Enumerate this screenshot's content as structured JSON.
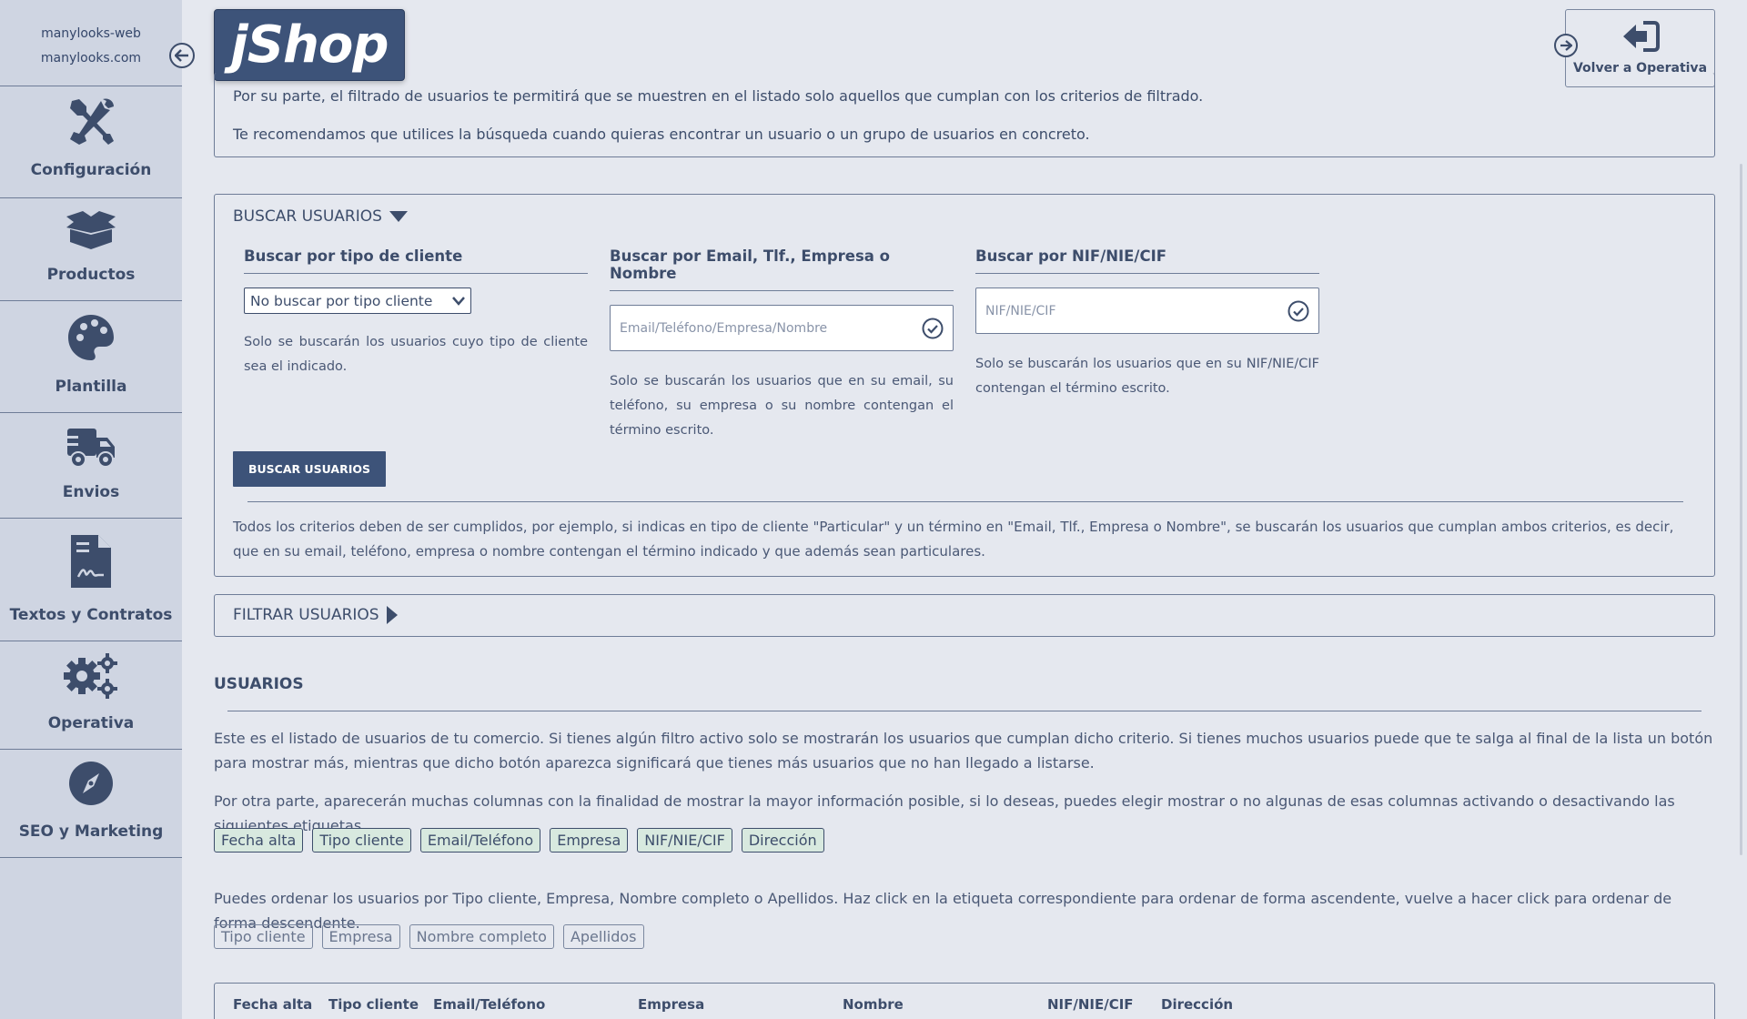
{
  "site": {
    "name": "manylooks-web",
    "domain": "manylooks.com"
  },
  "logo": {
    "text": "jShop"
  },
  "back_operativa": {
    "label": "Volver a Operativa"
  },
  "sidebar": {
    "items": [
      {
        "label": "Configuración",
        "icon": "tools-icon"
      },
      {
        "label": "Productos",
        "icon": "box-icon"
      },
      {
        "label": "Plantilla",
        "icon": "palette-icon"
      },
      {
        "label": "Envios",
        "icon": "truck-icon"
      },
      {
        "label": "Textos y Contratos",
        "icon": "contract-icon"
      },
      {
        "label": "Operativa",
        "icon": "gears-icon"
      },
      {
        "label": "SEO y Marketing",
        "icon": "compass-icon"
      }
    ]
  },
  "intro": {
    "line1": "Por su parte, el filtrado de usuarios te permitirá que se muestren en el listado solo aquellos que cumplan con los criterios de filtrado.",
    "line2": "Te recomendamos que utilices la búsqueda cuando quieras encontrar un usuario o un grupo de usuarios en concreto."
  },
  "search": {
    "title": "BUSCAR USUARIOS",
    "by_type": {
      "heading": "Buscar por tipo de cliente",
      "selected": "No buscar por tipo cliente",
      "help": "Solo se buscarán los usuarios cuyo tipo de cliente sea el indicado."
    },
    "by_email": {
      "heading": "Buscar por Email, Tlf., Empresa o Nombre",
      "placeholder": "Email/Teléfono/Empresa/Nombre",
      "help": "Solo se buscarán los usuarios que en su email, su teléfono, su empresa o su nombre contengan el término escrito."
    },
    "by_nif": {
      "heading": "Buscar por NIF/NIE/CIF",
      "placeholder": "NIF/NIE/CIF",
      "help": "Solo se buscarán los usuarios que en su NIF/NIE/CIF contengan el término escrito."
    },
    "button": "BUSCAR USUARIOS",
    "note": "Todos los criterios deben de ser cumplidos, por ejemplo, si indicas en tipo de cliente \"Particular\" y un término en \"Email, Tlf., Empresa o Nombre\", se buscarán los usuarios que cumplan ambos criterios, es decir, que en su email, teléfono, empresa o nombre contengan el término indicado y que además sean particulares."
  },
  "filter": {
    "title": "FILTRAR USUARIOS"
  },
  "users": {
    "heading": "USUARIOS",
    "para1": "Este es el listado de usuarios de tu comercio. Si tienes algún filtro activo solo se mostrarán los usuarios que cumplan dicho criterio. Si tienes muchos usuarios puede que te salga al final de la lista un botón para mostrar más, mientras que dicho botón aparezca significará que tienes más usuarios que no han llegado a listarse.",
    "para2": "Por otra parte, aparecerán muchas columnas con la finalidad de mostrar la mayor información posible, si lo deseas, puedes elegir mostrar o no algunas de esas columnas activando o desactivando las siguientes etiquetas.",
    "column_tags": [
      "Fecha alta",
      "Tipo cliente",
      "Email/Teléfono",
      "Empresa",
      "NIF/NIE/CIF",
      "Dirección"
    ],
    "para3": "Puedes ordenar los usuarios por Tipo cliente, Empresa, Nombre completo o Apellidos. Haz click en la etiqueta correspondiente para ordenar de forma ascendente, vuelve a hacer click para ordenar de forma descendente.",
    "sort_tags": [
      "Tipo cliente",
      "Empresa",
      "Nombre completo",
      "Apellidos"
    ],
    "table_headers": [
      "Fecha alta",
      "Tipo cliente",
      "Email/Teléfono",
      "Empresa",
      "Nombre",
      "NIF/NIE/CIF",
      "Dirección"
    ]
  },
  "colors": {
    "primary": "#3d5379",
    "sidebar": "#cfd5e2",
    "background": "#e5e8ef",
    "tag_active": "#d8e9df"
  }
}
